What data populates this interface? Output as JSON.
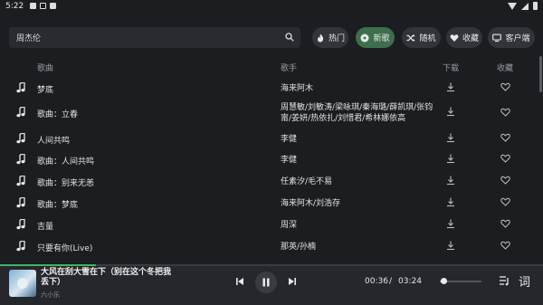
{
  "status_bar": {
    "time": "5:22"
  },
  "search": {
    "value": "周杰伦"
  },
  "nav_chips": [
    {
      "label": "热门",
      "icon": "flame-icon"
    },
    {
      "label": "新歌",
      "icon": "music-disc-icon",
      "active": true
    },
    {
      "label": "随机",
      "icon": "shuffle-icon"
    },
    {
      "label": "收藏",
      "icon": "heart-icon"
    },
    {
      "label": "客户端",
      "icon": "monitor-icon"
    }
  ],
  "table_header": {
    "song": "歌曲",
    "artist": "歌手",
    "download": "下载",
    "favorite": "收藏"
  },
  "songs": [
    {
      "name": "梦底",
      "artist": "海来阿木"
    },
    {
      "name": "歌曲：立春",
      "artist": "周慧敏/刘敏涛/梁咏琪/秦海璐/薛凯琪/张钧甯/姜妍/热依扎/刘惜君/希林娜依高"
    },
    {
      "name": "人间共鸣",
      "artist": "李健"
    },
    {
      "name": "歌曲：人间共鸣",
      "artist": "李健"
    },
    {
      "name": "歌曲：别来无恙",
      "artist": "任素汐/毛不易"
    },
    {
      "name": "歌曲：梦底",
      "artist": "海来阿木/刘浩存"
    },
    {
      "name": "吉量",
      "artist": "周深"
    },
    {
      "name": "只要有你(Live)",
      "artist": "那英/孙楠"
    }
  ],
  "player": {
    "title": "大风在刮大雪在下（别在这个冬把我丢下）",
    "artist": "六小乐",
    "current_time": "00:36",
    "separator": "/",
    "total_time": "03:24",
    "progress": 0.176,
    "volume": 0.1,
    "lyric_label": "词"
  },
  "colors": {
    "accent": "#3fb463",
    "background": "#1c1d21",
    "active_chip": "#3d6f4c"
  }
}
